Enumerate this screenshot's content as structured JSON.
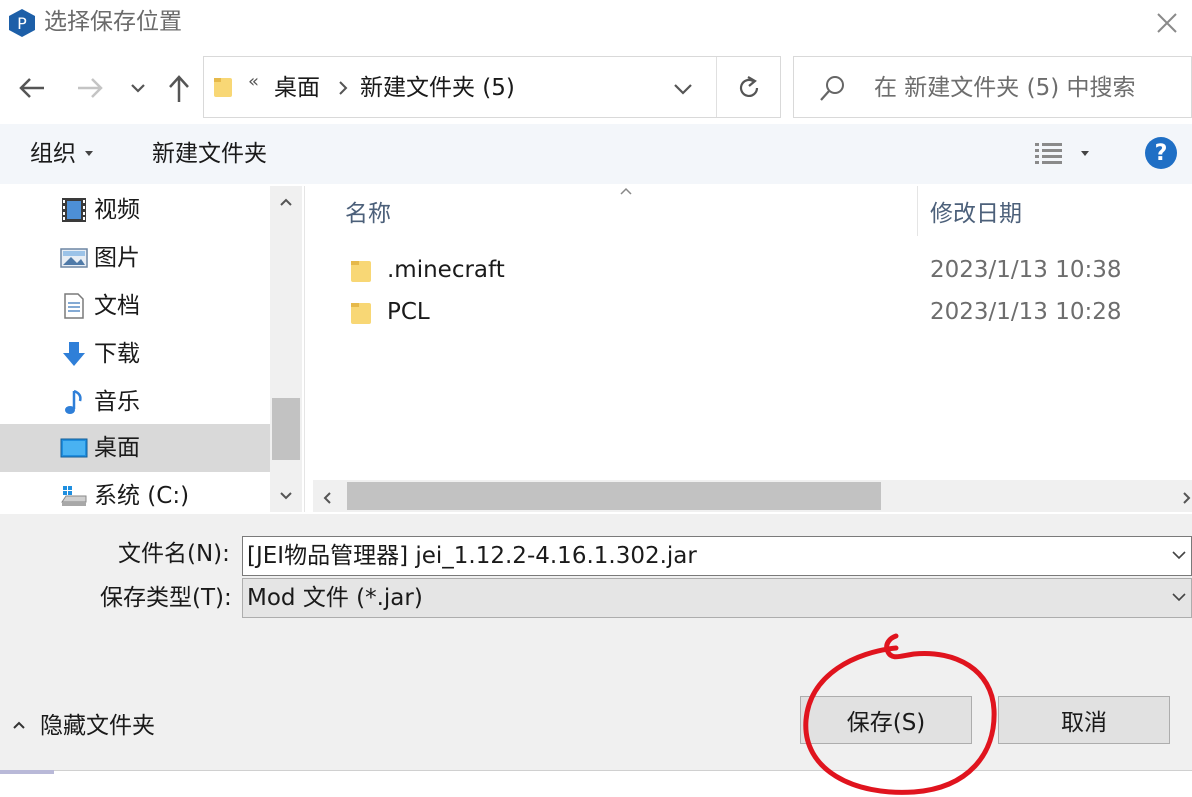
{
  "window": {
    "title": "选择保存位置",
    "app_icon_letter": "P"
  },
  "address": {
    "chevron": "«",
    "segments": [
      "桌面",
      "新建文件夹 (5)"
    ]
  },
  "search": {
    "placeholder": "在 新建文件夹 (5) 中搜索"
  },
  "toolbar": {
    "organize_label": "组织",
    "new_folder_label": "新建文件夹",
    "help_label": "?"
  },
  "sidebar": {
    "items": [
      {
        "label": "视频",
        "icon": "video-icon"
      },
      {
        "label": "图片",
        "icon": "picture-icon"
      },
      {
        "label": "文档",
        "icon": "document-icon"
      },
      {
        "label": "下载",
        "icon": "download-icon"
      },
      {
        "label": "音乐",
        "icon": "music-icon"
      },
      {
        "label": "桌面",
        "icon": "desktop-icon",
        "selected": true
      },
      {
        "label": "系统 (C:)",
        "icon": "drive-icon"
      }
    ]
  },
  "filelist": {
    "columns": {
      "name": "名称",
      "date": "修改日期"
    },
    "rows": [
      {
        "name": ".minecraft",
        "date": "2023/1/13 10:38"
      },
      {
        "name": "PCL",
        "date": "2023/1/13 10:28"
      }
    ]
  },
  "form": {
    "filename_label": "文件名(N):",
    "filename_value": "[JEI物品管理器] jei_1.12.2-4.16.1.302.jar",
    "filetype_label": "保存类型(T):",
    "filetype_value": "Mod 文件 (*.jar)"
  },
  "footer": {
    "hide_folders_label": "隐藏文件夹",
    "save_label": "保存(S)",
    "cancel_label": "取消"
  },
  "colors": {
    "accent": "#1f6fc5",
    "folder": "#f8d775",
    "annotation": "#e0141e"
  }
}
